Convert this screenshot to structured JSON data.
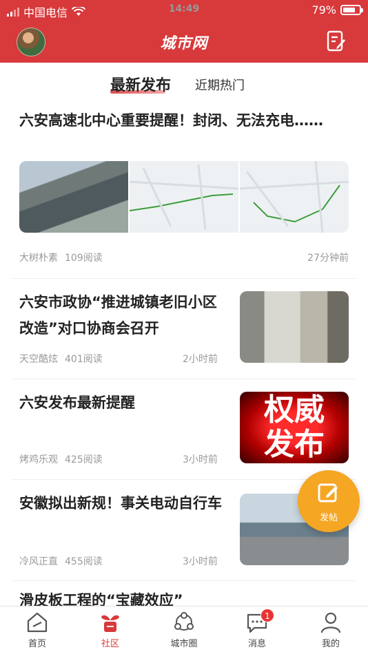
{
  "status_bar": {
    "carrier": "中国电信",
    "time": "14:49",
    "battery": "79%",
    "battery_level": 0.79,
    "icons": [
      "signal-icon",
      "wifi-icon",
      "battery-icon"
    ]
  },
  "header": {
    "logo": "城市网",
    "icons": [
      "avatar",
      "edit-icon"
    ],
    "bg_color": "#d8393b"
  },
  "tabs": {
    "active": "最新发布",
    "inactive": "近期热门"
  },
  "articles": [
    {
      "title": "六安高速北中心重要提醒！封闭、无法充电……",
      "author": "大树朴素",
      "reads": "109阅读",
      "time": "27分钟前"
    },
    {
      "title": "六安市政协“推进城镇老旧小区改造”对口协商会召开",
      "author": "天空酷炫",
      "reads": "401阅读",
      "time": "2小时前"
    },
    {
      "title": "六安发布最新提醒",
      "author": "烤鸡乐观",
      "reads": "425阅读",
      "time": "3小时前",
      "image_text": [
        "权威",
        "发布"
      ]
    },
    {
      "title": "安徽拟出新规！事关电动自行车",
      "author": "冷风正直",
      "reads": "455阅读",
      "time": "3小时前"
    }
  ],
  "partial_title": "滑皮板工程的“宝藏效应”",
  "fab": {
    "label": "发帖",
    "icon": "edit-icon",
    "color": "#f5a623"
  },
  "tabbar": [
    {
      "label": "首页",
      "icon": "home-icon"
    },
    {
      "label": "社区",
      "icon": "sprout-icon",
      "active": true
    },
    {
      "label": "城市圈",
      "icon": "circle-network-icon"
    },
    {
      "label": "消息",
      "icon": "message-icon",
      "badge": "1"
    },
    {
      "label": "我的",
      "icon": "user-icon"
    }
  ]
}
